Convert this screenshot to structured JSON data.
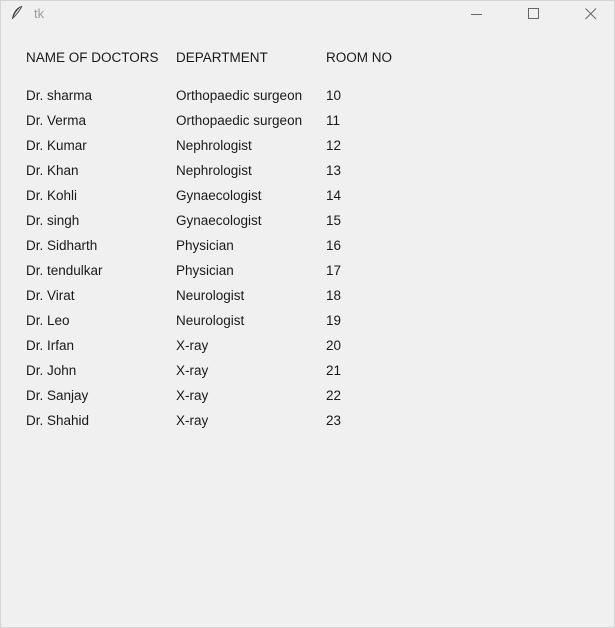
{
  "window": {
    "title": "tk"
  },
  "table": {
    "headers": [
      "NAME OF DOCTORS",
      "DEPARTMENT",
      "ROOM NO"
    ],
    "rows": [
      [
        "Dr. sharma",
        "Orthopaedic surgeon",
        "10"
      ],
      [
        "Dr. Verma",
        "Orthopaedic surgeon",
        "11"
      ],
      [
        "Dr. Kumar",
        "Nephrologist",
        "12"
      ],
      [
        "Dr. Khan",
        "Nephrologist",
        "13"
      ],
      [
        "Dr. Kohli",
        "Gynaecologist",
        "14"
      ],
      [
        "Dr. singh",
        "Gynaecologist",
        "15"
      ],
      [
        "Dr. Sidharth",
        "Physician",
        "16"
      ],
      [
        "Dr. tendulkar",
        "Physician",
        "17"
      ],
      [
        "Dr. Virat",
        "Neurologist",
        "18"
      ],
      [
        "Dr. Leo",
        "Neurologist",
        "19"
      ],
      [
        "Dr. Irfan",
        "X-ray",
        "20"
      ],
      [
        "Dr. John",
        "X-ray",
        "21"
      ],
      [
        "Dr. Sanjay",
        "X-ray",
        "22"
      ],
      [
        "Dr. Shahid",
        "X-ray",
        "23"
      ]
    ]
  }
}
